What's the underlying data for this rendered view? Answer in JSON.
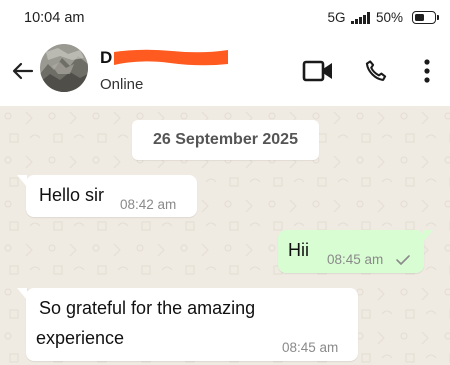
{
  "status_bar": {
    "time": "10:04 am",
    "network": "5G",
    "battery_text": "50%",
    "battery_level": 0.5
  },
  "header": {
    "contact_name": "D",
    "contact_status": "Online"
  },
  "chat": {
    "date_label": "26 September 2025",
    "messages": [
      {
        "direction": "incoming",
        "text": "Hello sir",
        "time": "08:42 am"
      },
      {
        "direction": "outgoing",
        "text": "Hii",
        "time": "08:45 am",
        "status": "delivered"
      },
      {
        "direction": "incoming",
        "text_line1": "So grateful for the amazing",
        "text_line2": "experience",
        "time": "08:45 am"
      }
    ]
  },
  "colors": {
    "chat_background": "#efeae2",
    "outgoing_bubble": "#d9fdd3",
    "incoming_bubble": "#ffffff",
    "redaction": "#ff5a1f"
  }
}
